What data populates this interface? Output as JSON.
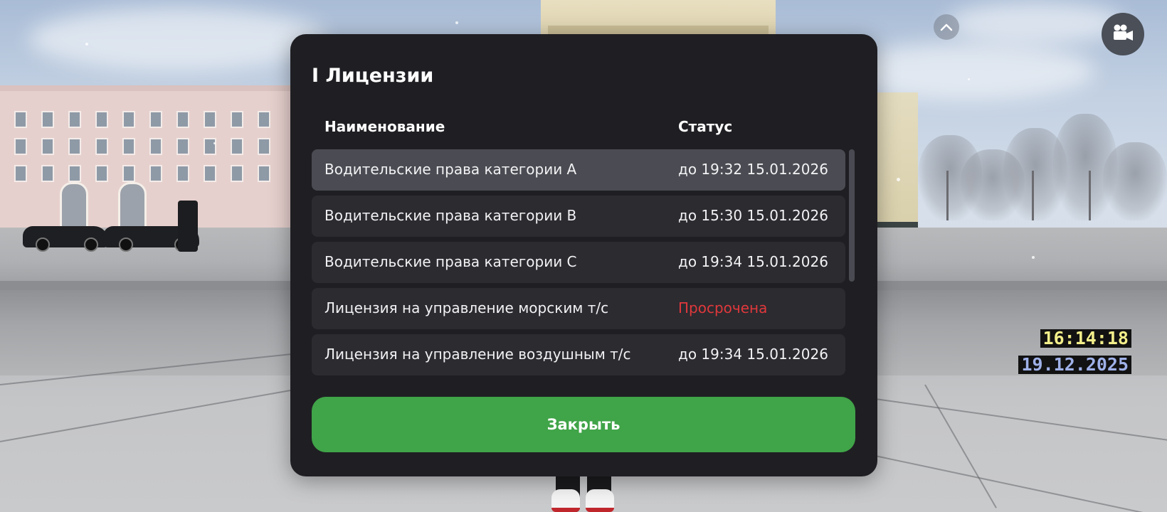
{
  "modal": {
    "title": "I Лицензии",
    "columns": {
      "name": "Наименование",
      "status": "Статус"
    },
    "rows": [
      {
        "name": "Водительские права категории A",
        "status": "до 19:32 15.01.2026",
        "expired": false,
        "selected": true
      },
      {
        "name": "Водительские права категории B",
        "status": "до 15:30 15.01.2026",
        "expired": false,
        "selected": false
      },
      {
        "name": "Водительские права категории C",
        "status": "до 19:34 15.01.2026",
        "expired": false,
        "selected": false
      },
      {
        "name": "Лицензия на управление морским т/с",
        "status": "Просрочена",
        "expired": true,
        "selected": false
      },
      {
        "name": "Лицензия на управление воздушным т/с",
        "status": "до 19:34 15.01.2026",
        "expired": false,
        "selected": false
      }
    ],
    "close_label": "Закрыть"
  },
  "hud": {
    "time": "16:14:18",
    "date": "19.12.2025",
    "camera_icon": "video-camera-icon",
    "collapse_icon": "chevron-up-icon"
  },
  "colors": {
    "modal_bg": "#1f1f23",
    "row_bg": "#2b2b30",
    "row_selected_bg": "#4b4c53",
    "expired_text": "#e0383b",
    "close_button": "#40a448",
    "clock_text": "#f3ef8a",
    "date_text": "#9fb1e8"
  }
}
